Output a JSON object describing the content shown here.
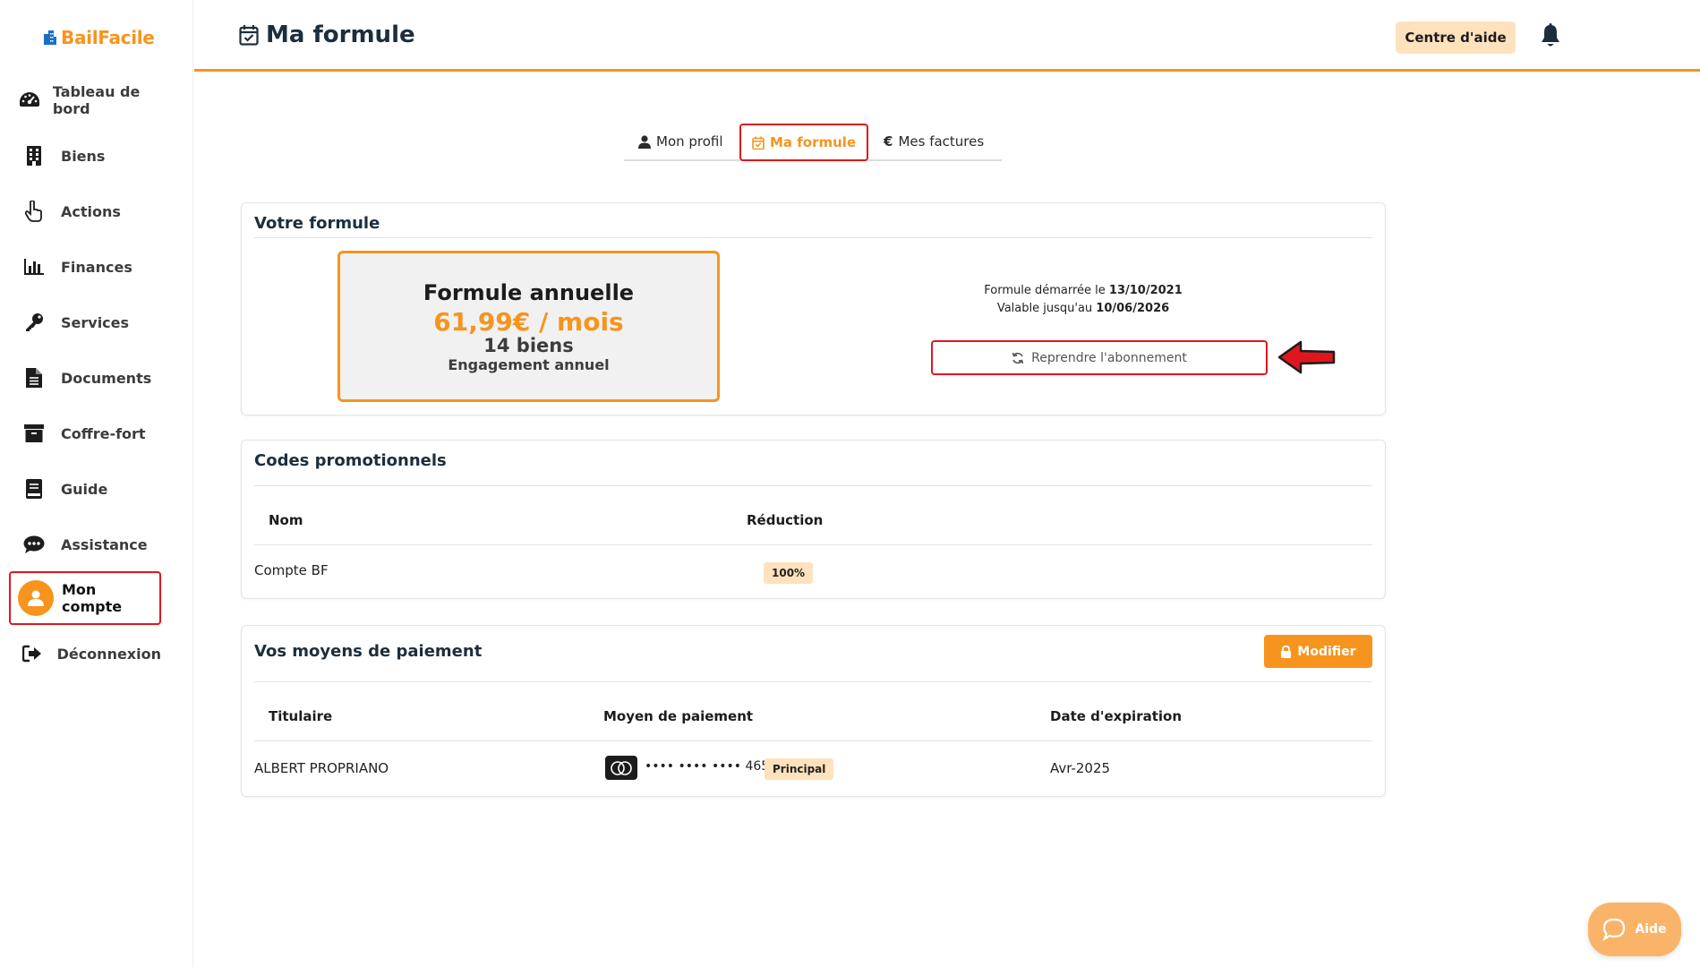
{
  "app": {
    "name": "BailFacile"
  },
  "sidebar": {
    "items": [
      {
        "label": "Tableau de bord",
        "icon": "gauge-icon"
      },
      {
        "label": "Biens",
        "icon": "building-icon"
      },
      {
        "label": "Actions",
        "icon": "hand-pointer-icon"
      },
      {
        "label": "Finances",
        "icon": "bar-chart-icon"
      },
      {
        "label": "Services",
        "icon": "key-icon"
      },
      {
        "label": "Documents",
        "icon": "document-icon"
      },
      {
        "label": "Coffre-fort",
        "icon": "archive-icon"
      },
      {
        "label": "Guide",
        "icon": "book-icon"
      },
      {
        "label": "Assistance",
        "icon": "chat-bubble-icon"
      },
      {
        "label": "Mon compte",
        "icon": "user-avatar-icon",
        "active": true
      },
      {
        "label": "Déconnexion",
        "icon": "sign-out-icon"
      }
    ]
  },
  "header": {
    "title": "Ma formule",
    "help_label": "Centre d'aide"
  },
  "tabs": [
    {
      "label": "Mon profil"
    },
    {
      "label": "Ma formule",
      "active": true
    },
    {
      "label": "Mes factures"
    }
  ],
  "formule": {
    "section_title": "Votre formule",
    "plan_name": "Formule annuelle",
    "price": "61,99€ / mois",
    "biens": "14 biens",
    "engagement": "Engagement annuel",
    "started_label": "Formule démarrée le",
    "started_date": "13/10/2021",
    "valid_label": "Valable jusqu'au",
    "valid_date": "10/06/2026",
    "resume_label": "Reprendre l'abonnement"
  },
  "promo": {
    "section_title": "Codes promotionnels",
    "col_name": "Nom",
    "col_reduction": "Réduction",
    "rows": [
      {
        "name": "Compte BF",
        "reduction": "100%"
      }
    ]
  },
  "payment": {
    "section_title": "Vos moyens de paiement",
    "modify_label": "Modifier",
    "col_holder": "Titulaire",
    "col_method": "Moyen de paiement",
    "col_expiry": "Date d'expiration",
    "rows": [
      {
        "holder": "ALBERT PROPRIANO",
        "card_number": "•••• •••• •••• 4659",
        "badge": "Principal",
        "expiry": "Avr-2025"
      }
    ]
  },
  "chat": {
    "label": "Aide"
  },
  "colors": {
    "accent": "#f7941d",
    "accent_light": "#fde2bd",
    "highlight": "#e0161e",
    "dark": "#1c2e3e"
  }
}
